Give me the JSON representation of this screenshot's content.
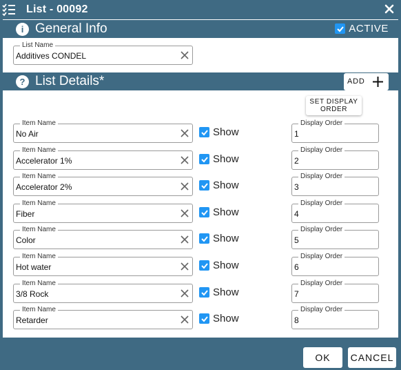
{
  "window": {
    "title": "List - 00092"
  },
  "general": {
    "title": "General Info",
    "active_label": "ACTIVE",
    "active_checked": true,
    "list_name": {
      "legend": "List Name",
      "value": "Additives CONDEL"
    }
  },
  "details": {
    "title": "List Details*",
    "add_label": "ADD",
    "set_order_line1": "SET DISPLAY",
    "set_order_line2": "ORDER",
    "item_legend": "Item Name",
    "order_legend": "Display Order",
    "show_label": "Show",
    "items": [
      {
        "name": "No Air",
        "show": true,
        "order": "1"
      },
      {
        "name": "Accelerator 1%",
        "show": true,
        "order": "2"
      },
      {
        "name": "Accelerator 2%",
        "show": true,
        "order": "3"
      },
      {
        "name": "Fiber",
        "show": true,
        "order": "4"
      },
      {
        "name": "Color",
        "show": true,
        "order": "5"
      },
      {
        "name": "Hot water",
        "show": true,
        "order": "6"
      },
      {
        "name": "3/8 Rock",
        "show": true,
        "order": "7"
      },
      {
        "name": "Retarder",
        "show": true,
        "order": "8"
      }
    ]
  },
  "footer": {
    "ok_label": "OK",
    "cancel_label": "CANCEL"
  },
  "colors": {
    "bar": "#3f6a83",
    "checkbox": "#2196f3"
  },
  "icons": {
    "app": "checklist-icon",
    "close": "close-icon",
    "general": "info-icon",
    "details": "help-icon",
    "add": "plus-icon",
    "clear": "clear-x-icon",
    "checkbox": "check-icon"
  }
}
